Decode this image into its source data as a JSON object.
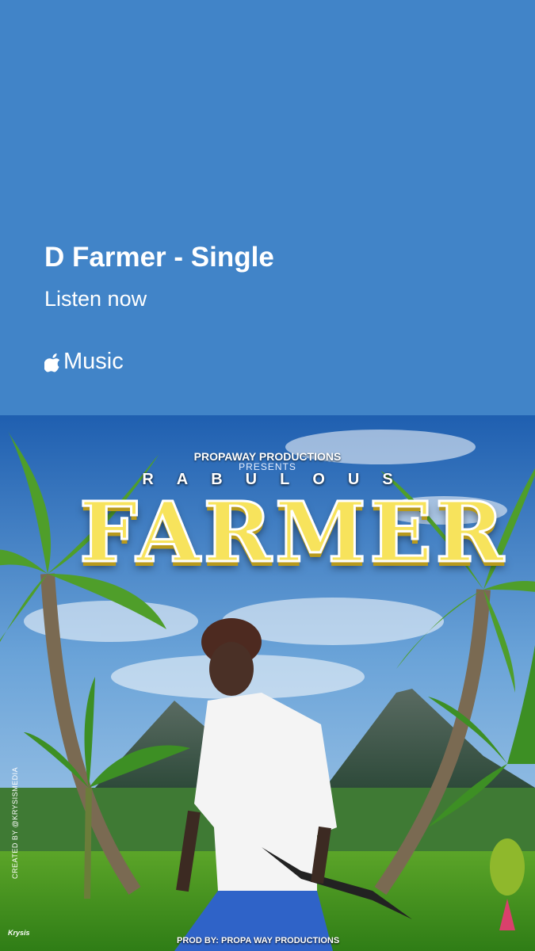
{
  "card": {
    "title": "D Farmer - Single",
    "subtitle": "Listen now",
    "service": "Music",
    "background_color": "#4184c8"
  },
  "icons": {
    "service_logo": "apple-logo-icon"
  },
  "artwork": {
    "presenter": "PROPAWAY PRODUCTIONS",
    "presents": "PRESENTS",
    "artist": "RABULOUS",
    "track_title": "FARMER",
    "designer_credit": "CREATED BY @KRYSISMEDIA",
    "producer_credit": "PROD BY: PROPA WAY PRODUCTIONS",
    "designer_mark": "Krysis"
  }
}
